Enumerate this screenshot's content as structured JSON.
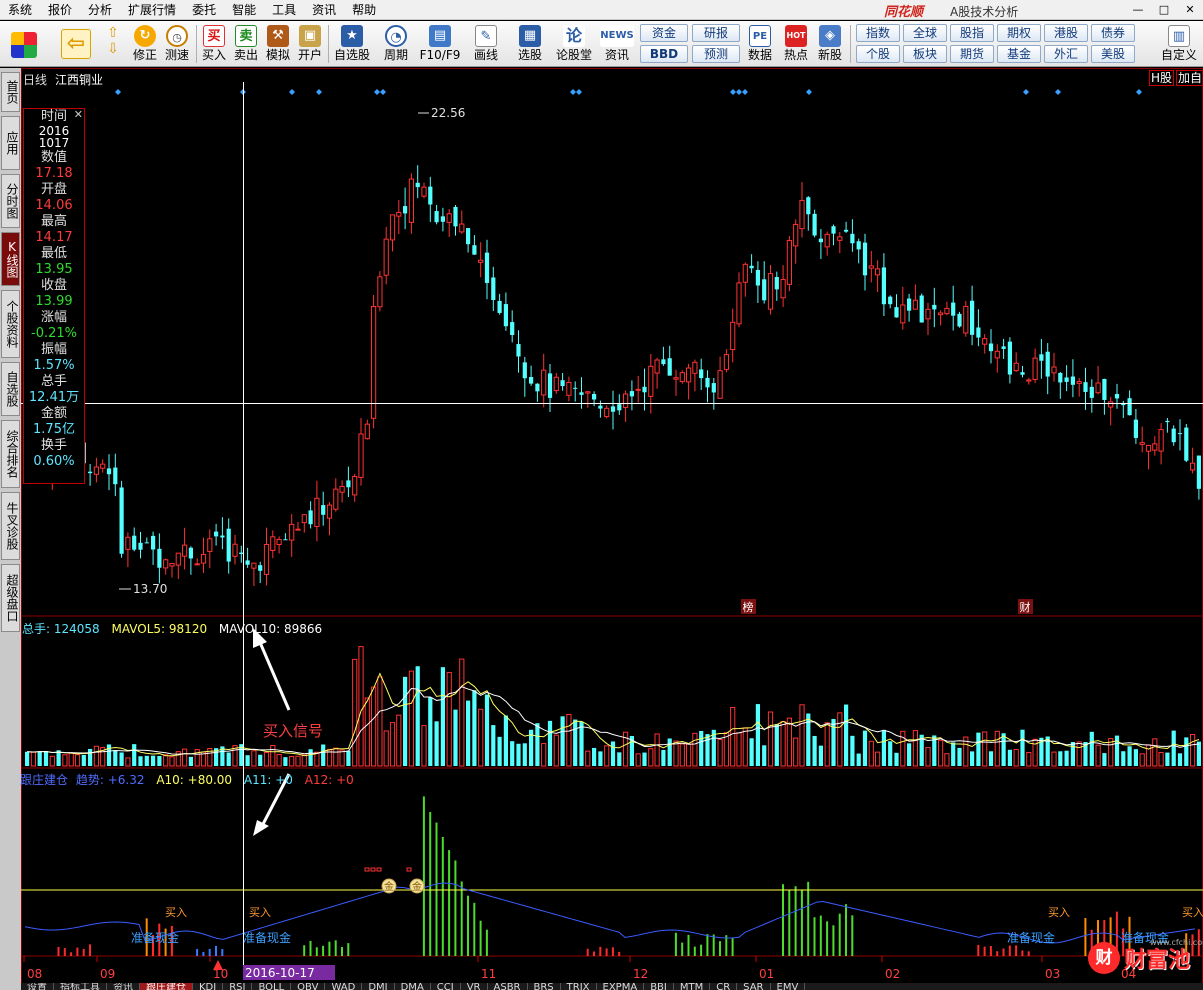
{
  "menu": [
    "系统",
    "报价",
    "分析",
    "扩展行情",
    "委托",
    "智能",
    "工具",
    "资讯",
    "帮助"
  ],
  "brand": "同花顺",
  "app_title": "A股技术分析",
  "window_controls": [
    "—",
    "□",
    "✕"
  ],
  "toolbar": {
    "buttons": [
      {
        "label": "",
        "icon": "layout-icon"
      },
      {
        "label": "",
        "icon": "back-arrow-icon"
      },
      {
        "label": "修正",
        "icon": "correction-icon"
      },
      {
        "label": "测速",
        "icon": "speedtest-icon"
      },
      {
        "label": "买入",
        "icon": "buy-icon",
        "glyph": "买"
      },
      {
        "label": "卖出",
        "icon": "sell-icon",
        "glyph": "卖"
      },
      {
        "label": "模拟",
        "icon": "hammer-icon"
      },
      {
        "label": "开户",
        "icon": "lock-icon"
      },
      {
        "label": "自选股",
        "icon": "star-icon"
      },
      {
        "label": "周期",
        "icon": "clock-icon"
      },
      {
        "label": "F10/F9",
        "icon": "f10-icon"
      },
      {
        "label": "画线",
        "icon": "pencil-icon"
      },
      {
        "label": "选股",
        "icon": "screen-icon"
      },
      {
        "label": "论股堂",
        "icon": "forum-icon"
      },
      {
        "label": "资讯",
        "icon": "news-icon",
        "glyph": "NEWS"
      },
      {
        "label": "数据",
        "icon": "data-icon",
        "glyph": "PE"
      },
      {
        "label": "热点",
        "icon": "hot-icon",
        "glyph": "HOT"
      },
      {
        "label": "新股",
        "icon": "ipo-icon"
      },
      {
        "label": "自定义",
        "icon": "custom-icon"
      }
    ],
    "chips_a": [
      "资金",
      "研报",
      "BBD",
      "预测"
    ],
    "chips_b": [
      "指数",
      "全球",
      "股指",
      "期权",
      "港股",
      "债券",
      "个股",
      "板块",
      "期货",
      "基金",
      "外汇",
      "美股"
    ]
  },
  "left_tabs": [
    "首页",
    "应用",
    "分时图",
    "K线图",
    "个股资料",
    "自选股",
    "综合排名",
    "牛叉诊股",
    "超级盘口"
  ],
  "chart": {
    "period_label": "日线",
    "stock_name": "江西铜业",
    "right_tags": [
      "H股",
      "加自"
    ],
    "max_price_label": "22.56",
    "min_price_label": "13.70",
    "event_tags": [
      "榜",
      "财"
    ],
    "crosshair_date": "2016-10-17",
    "x_labels": [
      "08",
      "09",
      "10",
      "11",
      "12",
      "01",
      "02",
      "03",
      "04"
    ],
    "colors": {
      "up": "#ff3232",
      "down": "#54ffff",
      "ma5": "#ffff60",
      "ma10": "#ffffff"
    }
  },
  "info_panel": {
    "time_label": "时间",
    "time_year": "2016",
    "time_md": "1017",
    "value_label": "数值",
    "value": "17.18",
    "open_label": "开盘",
    "open": "14.06",
    "high_label": "最高",
    "high": "14.17",
    "low_label": "最低",
    "low": "13.95",
    "close_label": "收盘",
    "close": "13.99",
    "change_label": "涨幅",
    "change": "-0.21%",
    "amplitude_label": "振幅",
    "amplitude": "1.57%",
    "volume_label": "总手",
    "volume": "12.41万",
    "amount_label": "金额",
    "amount": "1.75亿",
    "turnover_label": "换手",
    "turnover": "0.60%"
  },
  "volume_legend": {
    "total": "总手: 124058",
    "mavol5": "MAVOL5: 98120",
    "mavol10": "MAVOL10: 89866"
  },
  "indicator_legend": {
    "name": "跟庄建仓",
    "trend": "趋势: +6.32",
    "a10": "A10: +80.00",
    "a11": "A11: +0",
    "a12": "A12: +0"
  },
  "annotations": {
    "buy_signal": "买入信号",
    "buy": "买入",
    "prepare_cash": "准备现金",
    "coin": "金"
  },
  "bottom_tabs": [
    "设置",
    "指标工具",
    "资讯",
    "跟庄建仓",
    "KDJ",
    "RSI",
    "BOLL",
    "OBV",
    "WAD",
    "DMI",
    "DMA",
    "CCI",
    "VR",
    "ASBR",
    "BRS",
    "TRIX",
    "EXPMA",
    "BBI",
    "MTM",
    "CR",
    "SAR",
    "EMV"
  ],
  "watermark": {
    "text": "财富池",
    "badge": "财",
    "url": "www.cfchi.com"
  },
  "chart_data": {
    "type": "candlestick",
    "description_units": "CNY price, daily bars",
    "price_range": [
      13.7,
      22.56
    ],
    "crosshair": {
      "date": "2016-10-17",
      "open": 14.06,
      "high": 14.17,
      "low": 13.95,
      "close": 13.99
    },
    "volume_indicator": {
      "total": 124058,
      "mavol5": 98120,
      "mavol10": 89866
    },
    "x_labels": [
      "08",
      "09",
      "10",
      "11",
      "12",
      "01",
      "02",
      "03",
      "04"
    ]
  }
}
